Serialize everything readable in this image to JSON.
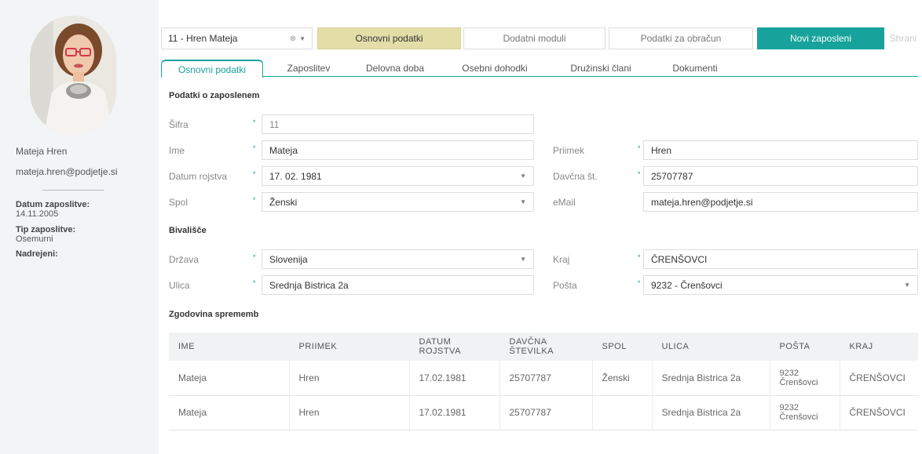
{
  "profile": {
    "name": "Mateja Hren",
    "email": "mateja.hren@podjetje.si",
    "hire_date_label": "Datum zaposlitve:",
    "hire_date": "14.11.2005",
    "employment_type_label": "Tip zaposlitve:",
    "employment_type": "Osemurni",
    "supervisor_label": "Nadrejeni:"
  },
  "topbar": {
    "employee_select": "11 - Hren Mateja",
    "btn_basic": "Osnovni podatki",
    "btn_modules": "Dodatni moduli",
    "btn_payroll": "Podatki za obračun",
    "btn_new": "Novi zaposleni",
    "btn_save": "Shrani"
  },
  "tabs": [
    "Osnovni podatki",
    "Zaposlitev",
    "Delovna doba",
    "Osebni dohodki",
    "Družinski člani",
    "Dokumenti"
  ],
  "section_employee": "Podatki o zaposlenem",
  "section_residence": "Bivališče",
  "section_history": "Zgodovina sprememb",
  "required_mark": "*",
  "fields": {
    "sifra": {
      "label": "Šifra",
      "value": "11"
    },
    "ime": {
      "label": "Ime",
      "value": "Mateja"
    },
    "priimek": {
      "label": "Priimek",
      "value": "Hren"
    },
    "datum": {
      "label": "Datum rojstva",
      "value": "17. 02. 1981"
    },
    "davcna": {
      "label": "Davčna št.",
      "value": "25707787"
    },
    "spol": {
      "label": "Spol",
      "value": "Ženski"
    },
    "email": {
      "label": "eMail",
      "value": "mateja.hren@podjetje.si"
    },
    "drzava": {
      "label": "Država",
      "value": "Slovenija"
    },
    "kraj": {
      "label": "Kraj",
      "value": "ČRENŠOVCI"
    },
    "ulica": {
      "label": "Ulica",
      "value": "Srednja Bistrica 2a"
    },
    "posta": {
      "label": "Pošta",
      "value": "9232 - Črenšovci"
    }
  },
  "history": {
    "columns": [
      "IME",
      "PRIIMEK",
      "DATUM ROJSTVA",
      "DAVČNA ŠTEVILKA",
      "SPOL",
      "ULICA",
      "POŠTA",
      "KRAJ"
    ],
    "rows": [
      [
        "Mateja",
        "Hren",
        "17.02.1981",
        "25707787",
        "Ženski",
        "Srednja Bistrica 2a",
        "9232 Črenšovci",
        "ČRENŠOVCI"
      ],
      [
        "Mateja",
        "Hren",
        "17.02.1981",
        "25707787",
        "",
        "Srednja Bistrica 2a",
        "9232 Črenšovci",
        "ČRENŠOVCI"
      ]
    ]
  },
  "colors": {
    "accent": "#17a39b",
    "active_button": "#e3dda7",
    "sidebar_bg": "#f3f4f6"
  }
}
